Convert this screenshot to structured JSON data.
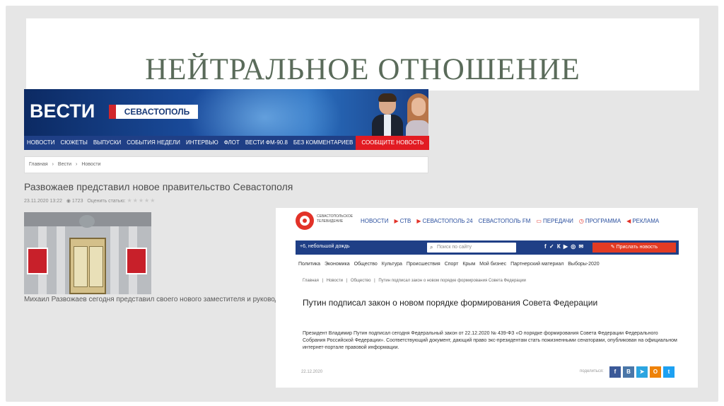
{
  "slide": {
    "title": "НЕЙТРАЛЬНОЕ ОТНОШЕНИЕ"
  },
  "vesti": {
    "logo": "ВЕСТИ",
    "city": "СЕВАСТОПОЛЬ",
    "nav": [
      "НОВОСТИ",
      "СЮЖЕТЫ",
      "ВЫПУСКИ",
      "СОБЫТИЯ НЕДЕЛИ",
      "ИНТЕРВЬЮ",
      "ФЛОТ",
      "ВЕСТИ ФМ-90.8",
      "БЕЗ КОММЕНТАРИЕВ"
    ],
    "report_label": "СООБЩИТЕ НОВОСТЬ",
    "breadcrumbs": [
      "Главная",
      "›",
      "Вести",
      "›",
      "Новости"
    ],
    "headline": "Развожаев представил новое правительство Севастополя",
    "meta_date": "23.11.2020 13:22",
    "meta_views": "1723",
    "meta_rating_label": "Оценить статью:",
    "meta_stars": "★★★★★",
    "caption": "Михаил Развожаев сегодня представил своего нового заместителя и руководите"
  },
  "stv": {
    "brand": "СЕВАСТОПОЛЬСКОЕ ТЕЛЕВИДЕНИЕ",
    "menu": [
      "НОВОСТИ",
      "СТВ",
      "СЕВАСТОПОЛЬ 24",
      "СЕВАСТОПОЛЬ FM",
      "ПЕРЕДАЧИ",
      "ПРОГРАММА",
      "РЕКЛАМА"
    ],
    "weather": "+6, небольшой дождь",
    "search_placeholder": "Поиск по сайту",
    "social": "f ✓ К ▶ ◎ ✉",
    "send_news": "Прислать новость",
    "categories": [
      "Политика",
      "Экономика",
      "Общество",
      "Культура",
      "Происшествия",
      "Спорт",
      "Крым",
      "Мой бизнес",
      "Партнерский материал",
      "Выборы-2020"
    ],
    "breadcrumbs": [
      "Главная",
      "|",
      "Новости",
      "|",
      "Общество",
      "|",
      "Путин подписал закон о новом порядке формирования Совета Федерации"
    ],
    "title": "Путин подписал закон о новом порядке формирования Совета Федерации",
    "body": "Президент Владимир Путин подписал сегодня Федеральный закон от 22.12.2020 № 439-ФЗ «О порядке формирования Совета Федерации Федерального Собрания Российской Федерации». Соответствующий документ, дающий право экс-президентам стать пожизненными сенаторами, опубликован на официальном интернет-портале правовой информации.",
    "date": "22.12.2020",
    "share_label": "поделиться:",
    "share_buttons": [
      {
        "label": "f",
        "color": "#3b5998"
      },
      {
        "label": "В",
        "color": "#4a76a8"
      },
      {
        "label": "➤",
        "color": "#2ca5e0"
      },
      {
        "label": "О",
        "color": "#ee8208"
      },
      {
        "label": "t",
        "color": "#1da1f2"
      }
    ]
  }
}
